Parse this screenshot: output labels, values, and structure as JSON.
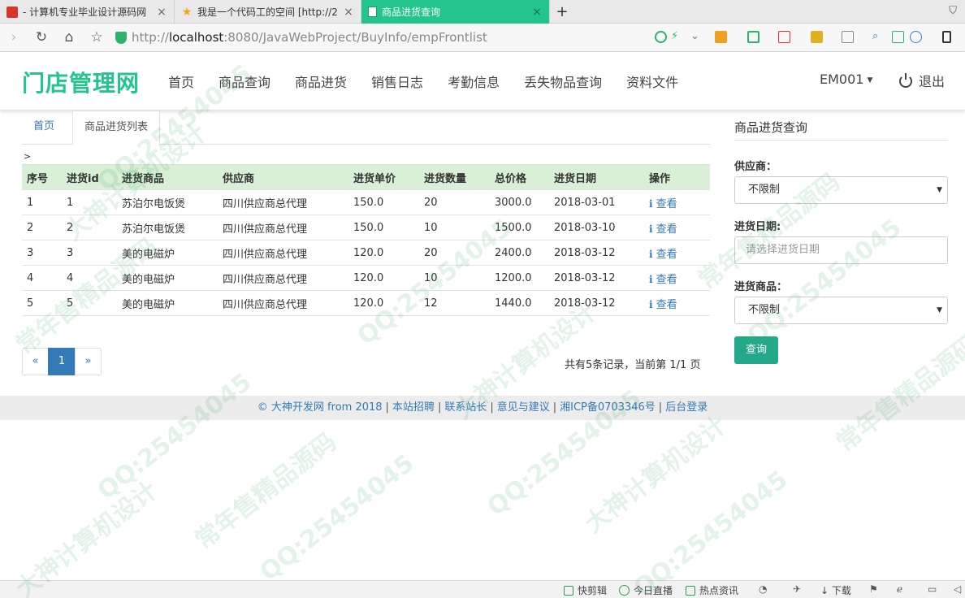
{
  "browser": {
    "tabs": [
      {
        "title": "- 计算机专业毕业设计源码网"
      },
      {
        "title": "我是一个代码工的空间 [http://2"
      },
      {
        "title": "商品进货查询"
      }
    ],
    "new_tab": "+",
    "url_scheme": "http://",
    "url_host": "localhost",
    "url_rest": ":8080/JavaWebProject/BuyInfo/empFrontlist"
  },
  "site": {
    "brand": "门店管理网",
    "nav": [
      "首页",
      "商品查询",
      "商品进货",
      "销售日志",
      "考勤信息",
      "丢失物品查询",
      "资料文件"
    ],
    "user": "EM001",
    "logout": "退出"
  },
  "breadcrumb": {
    "home": "首页",
    "current": "商品进货列表",
    "marker": ">"
  },
  "table": {
    "headers": [
      "序号",
      "进货id",
      "进货商品",
      "供应商",
      "进货单价",
      "进货数量",
      "总价格",
      "进货日期",
      "操作"
    ],
    "rows": [
      {
        "seq": "1",
        "id": "1",
        "goods": "苏泊尔电饭煲",
        "supplier": "四川供应商总代理",
        "price": "150.0",
        "qty": "20",
        "total": "3000.0",
        "date": "2018-03-01",
        "action": "查看"
      },
      {
        "seq": "2",
        "id": "2",
        "goods": "苏泊尔电饭煲",
        "supplier": "四川供应商总代理",
        "price": "150.0",
        "qty": "10",
        "total": "1500.0",
        "date": "2018-03-10",
        "action": "查看"
      },
      {
        "seq": "3",
        "id": "3",
        "goods": "美的电磁炉",
        "supplier": "四川供应商总代理",
        "price": "120.0",
        "qty": "20",
        "total": "2400.0",
        "date": "2018-03-12",
        "action": "查看"
      },
      {
        "seq": "4",
        "id": "4",
        "goods": "美的电磁炉",
        "supplier": "四川供应商总代理",
        "price": "120.0",
        "qty": "10",
        "total": "1200.0",
        "date": "2018-03-12",
        "action": "查看"
      },
      {
        "seq": "5",
        "id": "5",
        "goods": "美的电磁炉",
        "supplier": "四川供应商总代理",
        "price": "120.0",
        "qty": "12",
        "total": "1440.0",
        "date": "2018-03-12",
        "action": "查看"
      }
    ]
  },
  "pagination": {
    "prev": "«",
    "current": "1",
    "next": "»",
    "summary": "共有5条记录，当前第 1/1 页"
  },
  "query_panel": {
    "title": "商品进货查询",
    "supplier_label": "供应商：",
    "supplier_value": "不限制",
    "date_label": "进货日期:",
    "date_placeholder": "请选择进货日期",
    "goods_label": "进货商品：",
    "goods_value": "不限制",
    "submit": "查询"
  },
  "footer": {
    "links": [
      "© 大神开发网 from 2018",
      "本站招聘",
      "联系站长",
      "意见与建议",
      "湘ICP备0703346号",
      "后台登录"
    ],
    "separator": "|"
  },
  "statusbar": {
    "items": [
      "快剪辑",
      "今日直播",
      "热点资讯",
      "下载"
    ]
  },
  "watermark": {
    "texts": [
      "QQ:25454045",
      "常年售精品源码",
      "大神计算机设计"
    ]
  }
}
